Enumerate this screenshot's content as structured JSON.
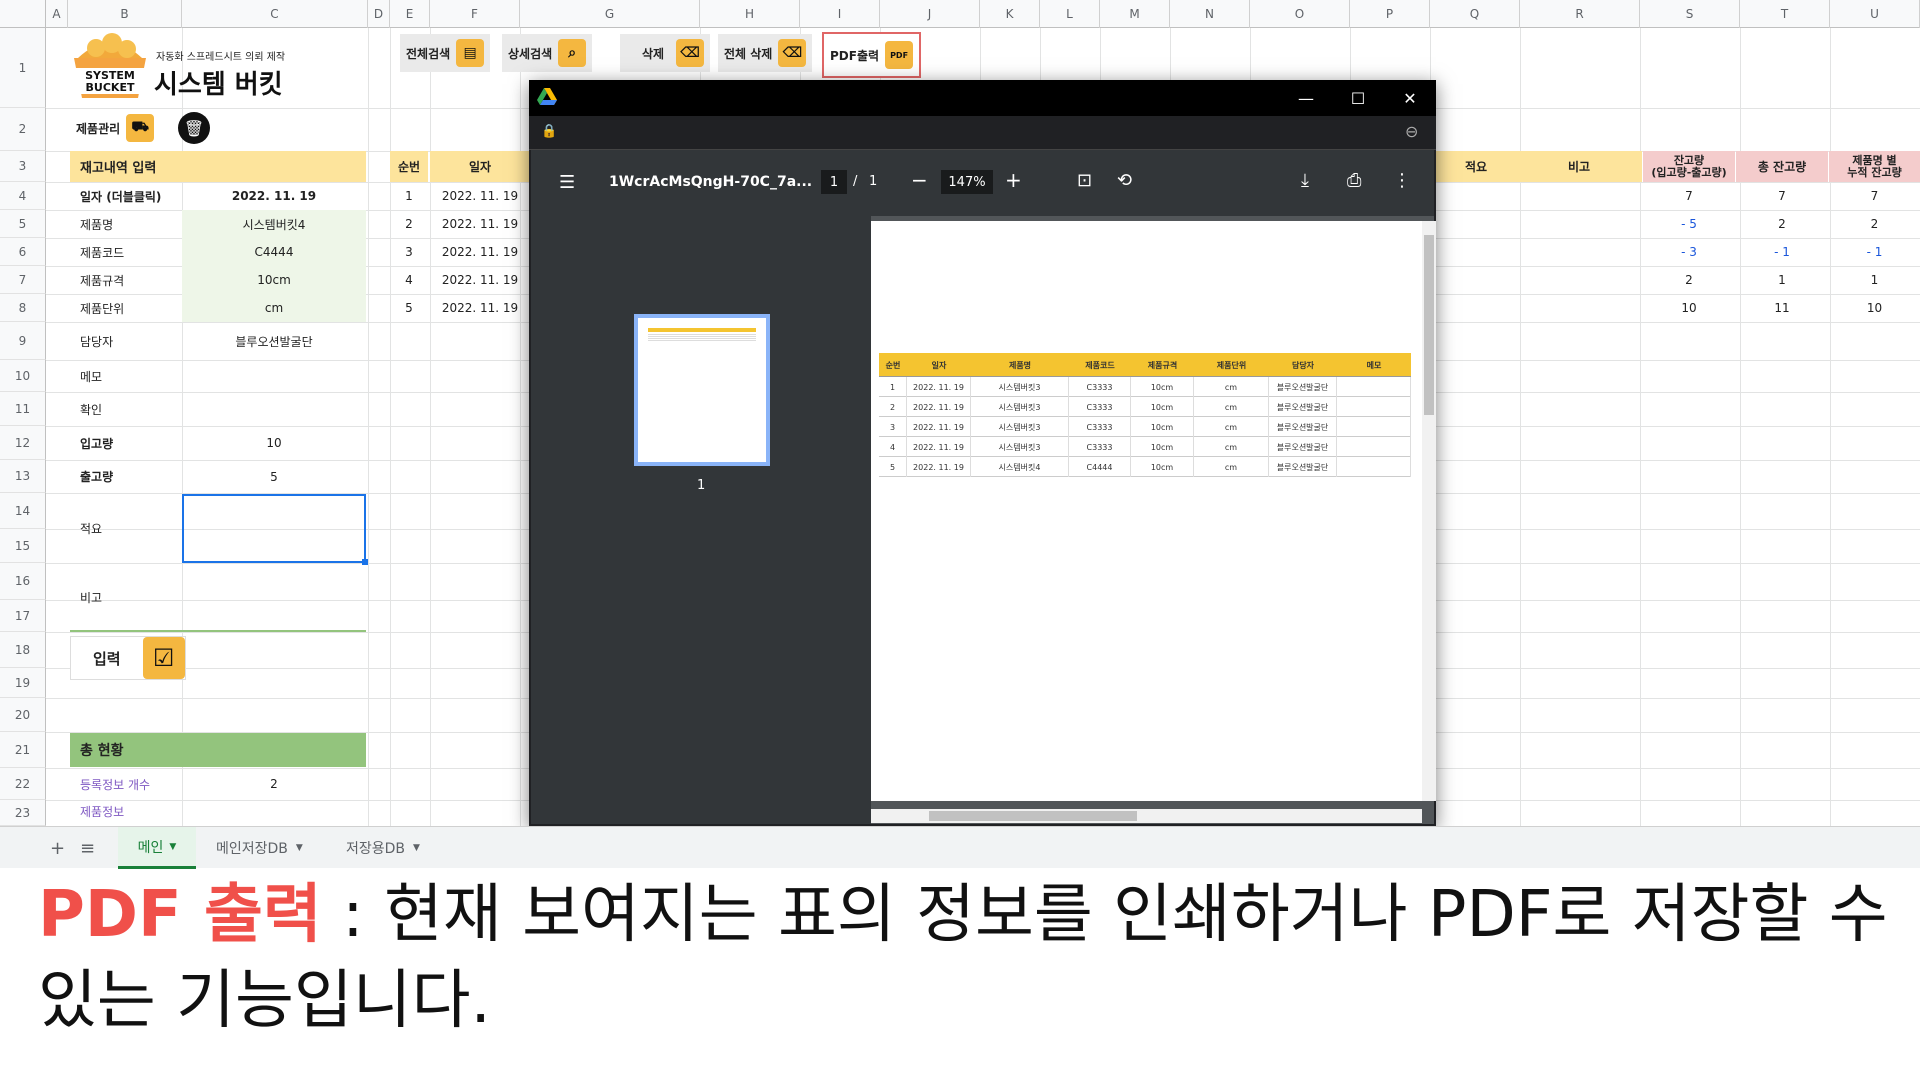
{
  "columns": [
    "A",
    "B",
    "C",
    "D",
    "E",
    "F",
    "G",
    "H",
    "I",
    "J",
    "K",
    "L",
    "M",
    "N",
    "O",
    "P",
    "Q",
    "R",
    "S",
    "T",
    "U"
  ],
  "rows": [
    "1",
    "2",
    "3",
    "4",
    "5",
    "6",
    "7",
    "8",
    "9",
    "10",
    "11",
    "12",
    "13",
    "14",
    "15",
    "16",
    "17",
    "18",
    "19",
    "20",
    "21",
    "22",
    "23"
  ],
  "logo": {
    "line1": "SYSTEM",
    "line2": "BUCKET",
    "subtitle": "자동화 스프레드시트 의뢰 제작",
    "title": "시스템 버킷"
  },
  "toolbar": {
    "product_mgmt": "제품관리",
    "search_all": "전체검색",
    "search_detail": "상세검색",
    "delete": "삭제",
    "delete_all": "전체 삭제",
    "pdf_export": "PDF출력",
    "pdf_icon": "PDF"
  },
  "form": {
    "header": "재고내역 입력",
    "fields": [
      {
        "label": "일자 (더블클릭)",
        "value": "2022. 11. 19"
      },
      {
        "label": "제품명",
        "value": "시스템버킷4"
      },
      {
        "label": "제품코드",
        "value": "C4444"
      },
      {
        "label": "제품규격",
        "value": "10cm"
      },
      {
        "label": "제품단위",
        "value": "cm"
      },
      {
        "label": "담당자",
        "value": "블루오션발굴단"
      },
      {
        "label": "메모",
        "value": ""
      },
      {
        "label": "확인",
        "value": ""
      },
      {
        "label": "입고량",
        "value": "10"
      },
      {
        "label": "출고량",
        "value": "5"
      },
      {
        "label": "적요",
        "value": ""
      },
      {
        "label": "비고",
        "value": ""
      }
    ],
    "submit": "입력",
    "summary_header": "총 현황",
    "summary_label": "등록정보 개수",
    "summary_value": "2",
    "partial_label": "제품정보"
  },
  "table": {
    "headers": {
      "no": "순번",
      "date": "일자",
      "remark1": "적요",
      "remark2": "비고",
      "bal1": "잔고량",
      "bal2": "(입고량-출고량)",
      "total": "총 잔고량",
      "cum1": "제품명 별",
      "cum2": "누적 잔고량"
    },
    "rows": [
      {
        "no": "1",
        "date": "2022. 11. 19",
        "bal": "7",
        "total": "7",
        "cum": "7"
      },
      {
        "no": "2",
        "date": "2022. 11. 19",
        "bal": "- 5",
        "total": "2",
        "cum": "2"
      },
      {
        "no": "3",
        "date": "2022. 11. 19",
        "bal": "- 3",
        "total": "- 1",
        "cum": "- 1"
      },
      {
        "no": "4",
        "date": "2022. 11. 19",
        "bal": "2",
        "total": "1",
        "cum": "1"
      },
      {
        "no": "5",
        "date": "2022. 11. 19",
        "bal": "10",
        "total": "11",
        "cum": "10"
      }
    ]
  },
  "pdf_viewer": {
    "filename": "1WcrAcMsQngH-70C_7a...",
    "page_current": "1",
    "page_sep": "/",
    "page_total": "1",
    "zoom": "147%",
    "thumb_label": "1",
    "table_headers": [
      "순번",
      "일자",
      "제품명",
      "제품코드",
      "제품규격",
      "제품단위",
      "담당자",
      "메모"
    ],
    "table_rows": [
      [
        "1",
        "2022. 11. 19",
        "시스템버킷3",
        "C3333",
        "10cm",
        "cm",
        "블루오션발굴단",
        ""
      ],
      [
        "2",
        "2022. 11. 19",
        "시스템버킷3",
        "C3333",
        "10cm",
        "cm",
        "블루오션발굴단",
        ""
      ],
      [
        "3",
        "2022. 11. 19",
        "시스템버킷3",
        "C3333",
        "10cm",
        "cm",
        "블루오션발굴단",
        ""
      ],
      [
        "4",
        "2022. 11. 19",
        "시스템버킷3",
        "C3333",
        "10cm",
        "cm",
        "블루오션발굴단",
        ""
      ],
      [
        "5",
        "2022. 11. 19",
        "시스템버킷4",
        "C4444",
        "10cm",
        "cm",
        "블루오션발굴단",
        ""
      ]
    ]
  },
  "tabs": {
    "add": "+",
    "list": "≡",
    "main": "메인",
    "main_db": "메인저장DB",
    "store_db": "저장용DB"
  },
  "caption": {
    "highlight": "PDF 출력",
    "text": " : 현재 보여지는 표의 정보를 인쇄하거나 PDF로 저장할 수 있는 기능입니다."
  },
  "colors": {
    "yellow": "#fde49c",
    "green": "#93c47d",
    "pink": "#f4cccc",
    "accent": "#f0504a",
    "red_box": "#e06666"
  }
}
